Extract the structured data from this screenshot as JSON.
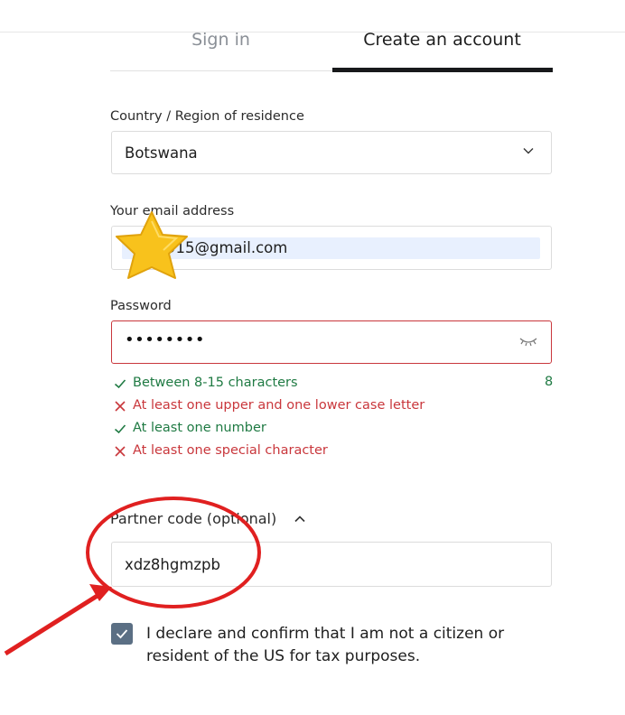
{
  "tabs": {
    "signin": "Sign in",
    "create": "Create an account"
  },
  "country": {
    "label": "Country / Region of residence",
    "value": "Botswana"
  },
  "email": {
    "label": "Your email address",
    "value": "915@gmail.com"
  },
  "password": {
    "label": "Password",
    "value": "••••••••"
  },
  "rules": [
    {
      "text": "Between 8-15 characters",
      "ok": true
    },
    {
      "text": "At least one upper and one lower case letter",
      "ok": false
    },
    {
      "text": "At least one number",
      "ok": true
    },
    {
      "text": "At least one special character",
      "ok": false
    }
  ],
  "password_length": "8",
  "partner": {
    "label": "Partner code (optional)",
    "value": "xdz8hgmzpb"
  },
  "declaration": {
    "checked": true,
    "text": "I declare and confirm that I am not a citizen or resident of the US for tax purposes."
  },
  "colors": {
    "valid": "#1f7a43",
    "invalid": "#c9373c",
    "tab_active": "#18191b",
    "checkbox": "#5b6f84",
    "annotation": "#e02020",
    "star": "#f8c21c"
  },
  "icons": [
    "chevron-down-icon",
    "eye-closed-icon",
    "check-icon",
    "x-icon",
    "chevron-up-icon",
    "checkmark-icon",
    "star-sticker-icon"
  ]
}
